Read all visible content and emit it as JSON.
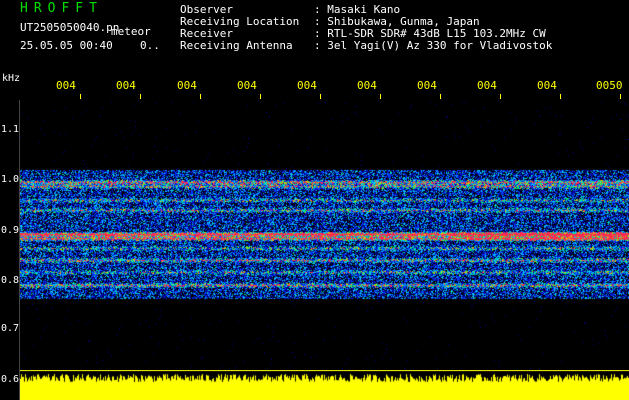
{
  "header": {
    "title": "HROFFT",
    "filename": "UT2505050040.pn",
    "meteor_label": "meteor",
    "timestamp": "25.05.05 00:40",
    "counter": "0.."
  },
  "info": [
    {
      "label": "Observer",
      "value": ": Masaki Kano"
    },
    {
      "label": "Receiving Location",
      "value": ": Shibukawa, Gunma, Japan"
    },
    {
      "label": "Receiver",
      "value": ": RTL-SDR SDR# 43dB L15 103.2MHz CW"
    },
    {
      "label": "Receiving Antenna",
      "value": ": 3el Yagi(V) Az 330 for Vladivostok"
    }
  ],
  "axis": {
    "unit": "kHz",
    "y_ticks": [
      "1.1",
      "1.0",
      "0.9",
      "0.8",
      "0.7",
      "0.6"
    ],
    "x_ticks": [
      "004",
      "004",
      "004",
      "004",
      "004",
      "004",
      "004",
      "004",
      "004",
      "0050"
    ]
  },
  "colors": {
    "text": "#ffffff",
    "title": "#00e000",
    "time_ticks": "#ffff00",
    "histogram": "#ffff00",
    "background": "#000000"
  }
}
